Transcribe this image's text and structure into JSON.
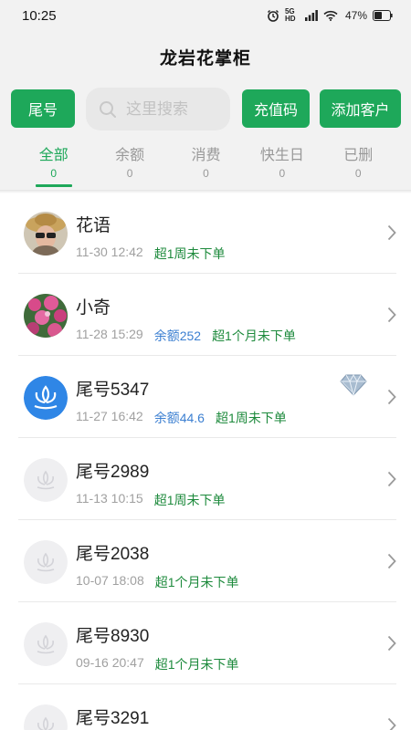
{
  "status_bar": {
    "time": "10:25",
    "network_label": "5G HD",
    "battery_percent": "47%"
  },
  "header": {
    "title": "龙岩花掌柜"
  },
  "toolbar": {
    "tail_button": "尾号",
    "search_placeholder": "这里搜索",
    "code_button": "充值码",
    "add_button": "添加客户"
  },
  "tabs": [
    {
      "label": "全部",
      "count": "0",
      "active": true
    },
    {
      "label": "余额",
      "count": "0",
      "active": false
    },
    {
      "label": "消费",
      "count": "0",
      "active": false
    },
    {
      "label": "快生日",
      "count": "0",
      "active": false
    },
    {
      "label": "已删",
      "count": "0",
      "active": false
    }
  ],
  "colors": {
    "accent": "#1ea85a",
    "balance": "#3b7fd1",
    "overdue": "#1d8a3c"
  },
  "customers": [
    {
      "name": "花语",
      "date": "11-30 12:42",
      "balance": "",
      "overdue": "超1周未下单",
      "avatar": "photo-woman-hat"
    },
    {
      "name": "小奇",
      "date": "11-28 15:29",
      "balance": "余额252",
      "overdue": "超1个月未下单",
      "avatar": "photo-flowers"
    },
    {
      "name": "尾号5347",
      "date": "11-27 16:42",
      "balance": "余额44.6",
      "overdue": "超1周未下单",
      "avatar": "lotus-logo-blue",
      "vip": "diamond-icon"
    },
    {
      "name": "尾号2989",
      "date": "11-13 10:15",
      "balance": "",
      "overdue": "超1周未下单",
      "avatar": "lotus-placeholder"
    },
    {
      "name": "尾号2038",
      "date": "10-07 18:08",
      "balance": "",
      "overdue": "超1个月未下单",
      "avatar": "lotus-placeholder"
    },
    {
      "name": "尾号8930",
      "date": "09-16 20:47",
      "balance": "",
      "overdue": "超1个月未下单",
      "avatar": "lotus-placeholder"
    },
    {
      "name": "尾号3291",
      "date": "",
      "balance": "",
      "overdue": "",
      "avatar": "lotus-placeholder"
    }
  ]
}
